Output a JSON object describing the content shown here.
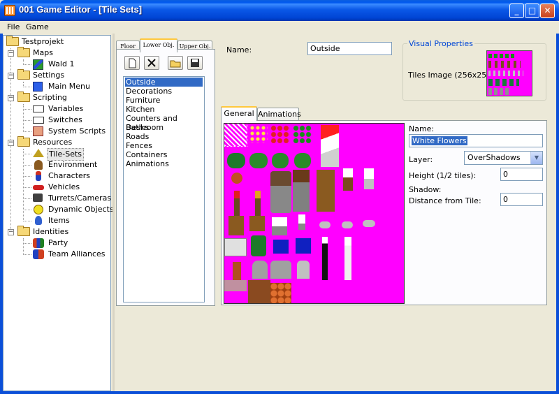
{
  "window": {
    "title": "001 Game Editor - [Tile Sets]",
    "minimize": "_",
    "maximize": "□",
    "close": "✕"
  },
  "menu": [
    "File",
    "Game"
  ],
  "tree": {
    "root": "Testprojekt",
    "maps": "Maps",
    "map_item": "Wald 1",
    "settings": "Settings",
    "settings_item": "Main Menu",
    "scripting": "Scripting",
    "scripting_items": [
      "Variables",
      "Switches",
      "System Scripts"
    ],
    "resources": "Resources",
    "resources_items": [
      "Tile-Sets",
      "Environment",
      "Characters",
      "Vehicles",
      "Turrets/Cameras",
      "Dynamic Objects",
      "Items"
    ],
    "identities": "Identities",
    "identities_items": [
      "Party",
      "Team Alliances"
    ],
    "expander_minus": "−"
  },
  "layer_tabs": [
    "Floor",
    "Lower Obj.",
    "Upper Obj."
  ],
  "tileset_list": [
    "Outside",
    "Decorations",
    "Furniture",
    "Kitchen",
    "Counters and Desks",
    "Bathroom",
    "Roads",
    "Fences",
    "Containers",
    "Animations"
  ],
  "tileset": {
    "name_label": "Name:",
    "name_value": "Outside",
    "visual_group": "Visual Properties",
    "tiles_image_label": "Tiles Image (256x256):"
  },
  "detail_tabs": [
    "General",
    "Animations"
  ],
  "tile_props": {
    "name_label": "Name:",
    "name_value": "White Flowers",
    "layer_label": "Layer:",
    "layer_value": "OverShadows",
    "height_label": "Height (1/2 tiles):",
    "height_value": "0",
    "shadow_label": "Shadow:",
    "distance_label": "Distance from Tile:",
    "distance_value": "0",
    "dropdown_glyph": "▼"
  },
  "colors": {
    "accent": "#316ac5",
    "titlebar": "#0058ee",
    "tile_background": "#ff00ff",
    "group_title": "#0046d5"
  }
}
